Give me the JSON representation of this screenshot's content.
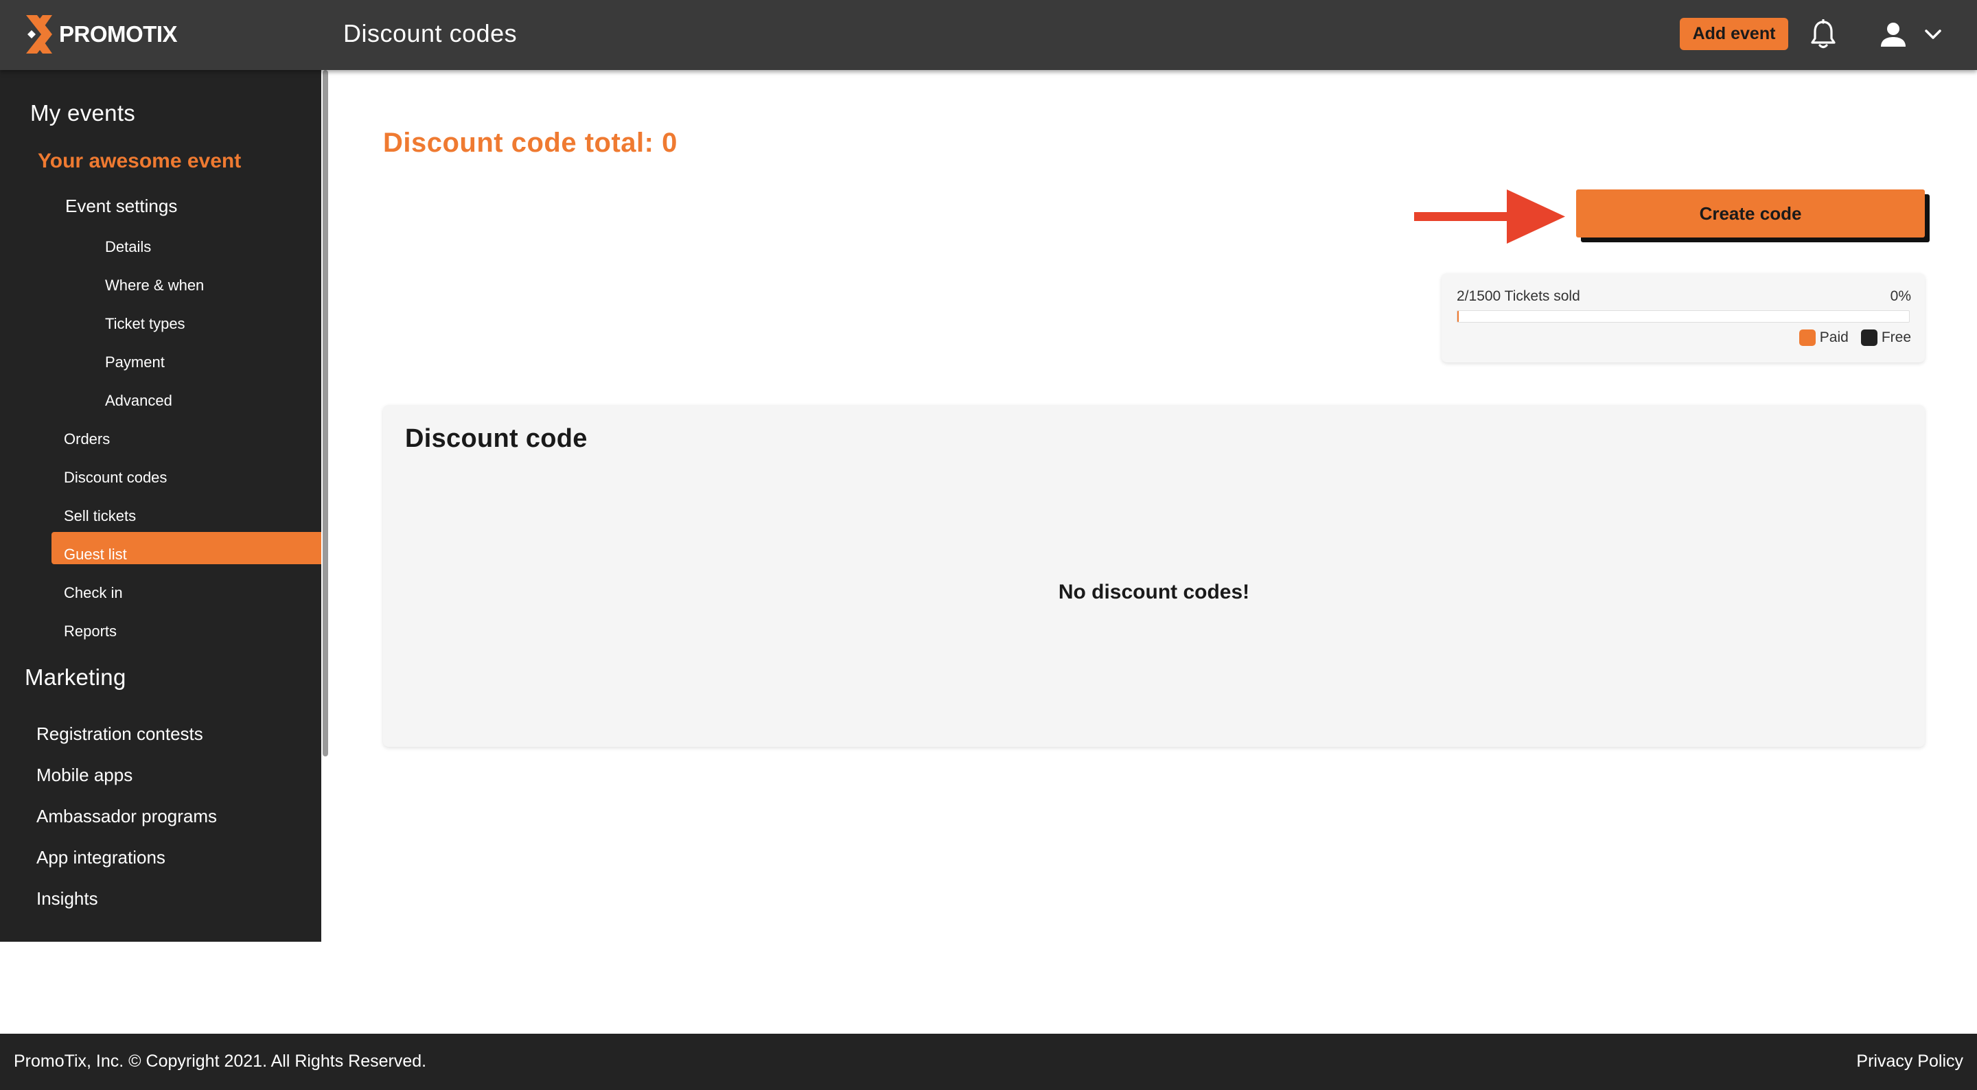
{
  "header": {
    "brand": "PROMOTIX",
    "title": "Discount codes",
    "add_event_label": "Add event",
    "icons": [
      "bell-icon",
      "user-icon",
      "chevron-down-icon"
    ]
  },
  "sidebar": {
    "my_events": "My events",
    "event_name": "Your awesome event",
    "event_settings": "Event settings",
    "settings_items": [
      "Details",
      "Where & when",
      "Ticket types",
      "Payment",
      "Advanced"
    ],
    "event_items": [
      "Orders",
      "Discount codes",
      "Sell tickets",
      "Guest list",
      "Check in",
      "Reports"
    ],
    "active_item": "Discount codes",
    "marketing": "Marketing",
    "marketing_items": [
      "Registration contests",
      "Mobile apps",
      "Ambassador programs",
      "App integrations",
      "Insights"
    ]
  },
  "main": {
    "total_label": "Discount code total: 0",
    "create_label": "Create code",
    "tickets": {
      "label": "2/1500 Tickets sold",
      "percent_label": "0%",
      "sold_fraction": 0.0013,
      "legend": {
        "paid": "Paid",
        "free": "Free"
      }
    },
    "codes_card": {
      "title": "Discount code",
      "empty_message": "No discount codes!"
    }
  },
  "footer": {
    "copyright": "PromoTix, Inc. © Copyright 2021. All Rights Reserved.",
    "privacy": "Privacy Policy"
  },
  "colors": {
    "accent": "#ef7a31",
    "topbar": "#3a3a3a",
    "sidebar": "#232323",
    "annotation_arrow": "#e8432b"
  }
}
